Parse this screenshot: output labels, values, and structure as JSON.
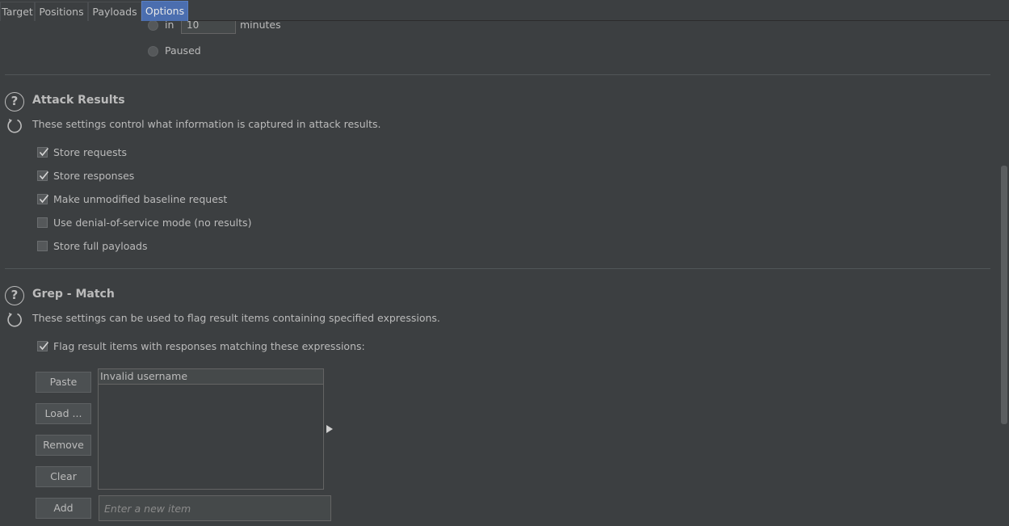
{
  "tabs": [
    {
      "label": "Target"
    },
    {
      "label": "Positions"
    },
    {
      "label": "Payloads"
    },
    {
      "label": "Options"
    }
  ],
  "resource_pool": {
    "in_label": "in",
    "minutes_value": "10",
    "minutes_label": "minutes",
    "paused_label": "Paused"
  },
  "attack_results": {
    "title": "Attack Results",
    "description": "These settings control what information is captured in attack results.",
    "options": [
      {
        "label": "Store requests",
        "checked": true
      },
      {
        "label": "Store responses",
        "checked": true
      },
      {
        "label": "Make unmodified baseline request",
        "checked": true
      },
      {
        "label": "Use denial-of-service mode (no results)",
        "checked": false
      },
      {
        "label": "Store full payloads",
        "checked": false
      }
    ]
  },
  "grep_match": {
    "title": "Grep - Match",
    "description": "These settings can be used to flag result items containing specified expressions.",
    "flag_label": "Flag result items with responses matching these expressions:",
    "flag_checked": true,
    "buttons": {
      "paste": "Paste",
      "load": "Load ...",
      "remove": "Remove",
      "clear": "Clear",
      "add": "Add"
    },
    "items": [
      "Invalid username"
    ],
    "new_item_placeholder": "Enter a new item"
  },
  "colors": {
    "background": "#3c3f41",
    "active_tab": "#4b6eaf",
    "text": "#bbbbbb"
  }
}
